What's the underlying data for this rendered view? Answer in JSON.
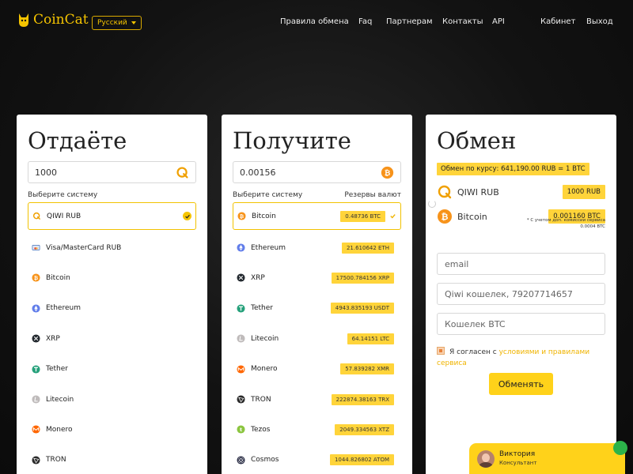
{
  "header": {
    "logo_text": "CoinCat",
    "language": "Русский",
    "nav": [
      {
        "label": "Правила обмена"
      },
      {
        "label": "Faq"
      },
      {
        "label": "Партнерам"
      },
      {
        "label": "Контакты"
      },
      {
        "label": "API"
      }
    ],
    "cabinet": "Кабинет",
    "logout": "Выход"
  },
  "give": {
    "title": "Отдаёте",
    "amount": "1000",
    "amount_icon": "qiwi-icon",
    "select_label": "Выберите систему",
    "items": [
      {
        "name": "QIWI RUB",
        "icon": "qiwi-icon",
        "selected": true
      },
      {
        "name": "Visa/MasterCard RUB",
        "icon": "card-icon"
      },
      {
        "name": "Bitcoin",
        "icon": "bitcoin-icon"
      },
      {
        "name": "Ethereum",
        "icon": "ethereum-icon"
      },
      {
        "name": "XRP",
        "icon": "xrp-icon"
      },
      {
        "name": "Tether",
        "icon": "tether-icon"
      },
      {
        "name": "Litecoin",
        "icon": "litecoin-icon"
      },
      {
        "name": "Monero",
        "icon": "monero-icon"
      },
      {
        "name": "TRON",
        "icon": "tron-icon"
      }
    ]
  },
  "receive": {
    "title": "Получите",
    "amount": "0.00156",
    "amount_icon": "bitcoin-icon",
    "select_label": "Выберите систему",
    "reserves_label": "Резервы валют",
    "items": [
      {
        "name": "Bitcoin",
        "reserve": "0.48736 BTC",
        "icon": "bitcoin-icon",
        "selected": true
      },
      {
        "name": "Ethereum",
        "reserve": "21.610642 ETH",
        "icon": "ethereum-icon"
      },
      {
        "name": "XRP",
        "reserve": "17500.784156 XRP",
        "icon": "xrp-icon"
      },
      {
        "name": "Tether",
        "reserve": "4943.835193 USDT",
        "icon": "tether-icon"
      },
      {
        "name": "Litecoin",
        "reserve": "64.14151 LTC",
        "icon": "litecoin-icon"
      },
      {
        "name": "Monero",
        "reserve": "57.839282 XMR",
        "icon": "monero-icon"
      },
      {
        "name": "TRON",
        "reserve": "222874.38163 TRX",
        "icon": "tron-icon"
      },
      {
        "name": "Tezos",
        "reserve": "2049.334563 XTZ",
        "icon": "tezos-icon"
      },
      {
        "name": "Cosmos",
        "reserve": "1044.826802 ATOM",
        "icon": "cosmos-icon"
      }
    ]
  },
  "exchange": {
    "title": "Обмен",
    "rate": "Обмен по курсу: 641,190.00 RUB = 1 BTC",
    "from_name": "QIWI RUB",
    "from_amount": "1000 RUB",
    "to_name": "Bitcoin",
    "to_amount": "0.001160 BTC",
    "commission_note": "* С учетом доп. комиссии сервиса 0.0004 BTC",
    "email_placeholder": "email",
    "wallet_from_placeholder": "Qiwi кошелек, 79207714657",
    "wallet_to_placeholder": "Кошелек BTC",
    "agree_text": "Я согласен с ",
    "agree_link": "условиями и правилами сервиса",
    "submit": "Обменять"
  },
  "chat": {
    "name": "Виктория",
    "role": "Консультант"
  },
  "colors": {
    "accent": "#f5c400",
    "badge": "#ffd43a",
    "background": "#121212"
  }
}
